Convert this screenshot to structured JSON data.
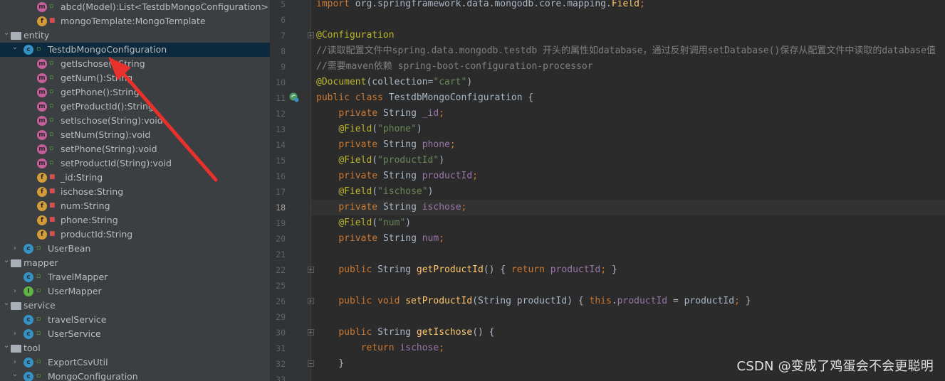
{
  "tree": {
    "rows": [
      {
        "label": "abcd(Model):List<TestdbMongoConfiguration>",
        "icon": "m",
        "vis": "pub",
        "indent": "method"
      },
      {
        "label": "mongoTemplate:MongoTemplate",
        "icon": "f",
        "vis": "priv",
        "indent": "method"
      },
      {
        "label": "entity",
        "icon": "folder",
        "arrow": "down",
        "indent": "pkg"
      },
      {
        "label": "TestdbMongoConfiguration",
        "icon": "c",
        "vis": "pub",
        "arrow": "down",
        "indent": "class",
        "selected": true
      },
      {
        "label": "getIschose():String",
        "icon": "m",
        "vis": "pub",
        "indent": "member"
      },
      {
        "label": "getNum():String",
        "icon": "m",
        "vis": "pub",
        "indent": "member"
      },
      {
        "label": "getPhone():String",
        "icon": "m",
        "vis": "pub",
        "indent": "member"
      },
      {
        "label": "getProductId():String",
        "icon": "m",
        "vis": "pub",
        "indent": "member"
      },
      {
        "label": "setIschose(String):void",
        "icon": "m",
        "vis": "pub",
        "indent": "member"
      },
      {
        "label": "setNum(String):void",
        "icon": "m",
        "vis": "pub",
        "indent": "member"
      },
      {
        "label": "setPhone(String):void",
        "icon": "m",
        "vis": "pub",
        "indent": "member"
      },
      {
        "label": "setProductId(String):void",
        "icon": "m",
        "vis": "pub",
        "indent": "member"
      },
      {
        "label": "_id:String",
        "icon": "f",
        "vis": "priv",
        "indent": "member"
      },
      {
        "label": "ischose:String",
        "icon": "f",
        "vis": "priv",
        "indent": "member"
      },
      {
        "label": "num:String",
        "icon": "f",
        "vis": "priv",
        "indent": "member"
      },
      {
        "label": "phone:String",
        "icon": "f",
        "vis": "priv",
        "indent": "member"
      },
      {
        "label": "productId:String",
        "icon": "f",
        "vis": "priv",
        "indent": "member"
      },
      {
        "label": "UserBean",
        "icon": "c",
        "vis": "pub",
        "arrow": "right",
        "indent": "class"
      },
      {
        "label": "mapper",
        "icon": "folder",
        "arrow": "down",
        "indent": "pkg"
      },
      {
        "label": "TravelMapper",
        "icon": "c",
        "vis": "pub",
        "indent": "class"
      },
      {
        "label": "UserMapper",
        "icon": "i",
        "vis": "pub",
        "arrow": "right",
        "indent": "class"
      },
      {
        "label": "service",
        "icon": "folder",
        "arrow": "down",
        "indent": "pkg"
      },
      {
        "label": "travelService",
        "icon": "c",
        "vis": "pub",
        "indent": "class"
      },
      {
        "label": "UserService",
        "icon": "c",
        "vis": "pub",
        "arrow": "right",
        "indent": "class"
      },
      {
        "label": "tool",
        "icon": "folder",
        "arrow": "down",
        "indent": "pkg"
      },
      {
        "label": "ExportCsvUtil",
        "icon": "c",
        "vis": "pub",
        "arrow": "right",
        "indent": "class"
      },
      {
        "label": "MongoConfiguration",
        "icon": "c",
        "vis": "pub",
        "arrow": "down",
        "indent": "class"
      }
    ]
  },
  "editor": {
    "current_line": "18",
    "lines": [
      {
        "n": "5",
        "html": [
          [
            "kw",
            "import "
          ],
          [
            "",
            "org.springframework.data.mongodb.core.mapping."
          ],
          [
            "fn",
            "Field"
          ],
          [
            "kw",
            ";"
          ]
        ]
      },
      {
        "n": "6",
        "html": []
      },
      {
        "n": "7",
        "html": [
          [
            "an",
            "@Configuration"
          ]
        ]
      },
      {
        "n": "8",
        "html": [
          [
            "cm",
            "//读取配置文件中spring.data.mongodb.testdb 开头的属性如database，通过反射调用setDatabase()保存从配置文件中读取的database值"
          ]
        ]
      },
      {
        "n": "9",
        "html": [
          [
            "cm",
            "//需要maven依赖 spring-boot-configuration-processor"
          ]
        ]
      },
      {
        "n": "10",
        "html": [
          [
            "an",
            "@Document"
          ],
          [
            "",
            "(collection="
          ],
          [
            "st",
            "\"cart\""
          ],
          [
            "",
            ")"
          ]
        ]
      },
      {
        "n": "11",
        "html": [
          [
            "kw",
            "public class "
          ],
          [
            "",
            "TestdbMongoConfiguration {"
          ]
        ]
      },
      {
        "n": "12",
        "html": [
          [
            "",
            "    "
          ],
          [
            "kw",
            "private "
          ],
          [
            "",
            "String "
          ],
          [
            "fd",
            "_id"
          ],
          [
            "kw",
            ";"
          ]
        ]
      },
      {
        "n": "13",
        "html": [
          [
            "",
            "    "
          ],
          [
            "an",
            "@Field"
          ],
          [
            "",
            "("
          ],
          [
            "st",
            "\"phone\""
          ],
          [
            "",
            ")"
          ]
        ]
      },
      {
        "n": "14",
        "html": [
          [
            "",
            "    "
          ],
          [
            "kw",
            "private "
          ],
          [
            "",
            "String "
          ],
          [
            "fd",
            "phone"
          ],
          [
            "kw",
            ";"
          ]
        ]
      },
      {
        "n": "15",
        "html": [
          [
            "",
            "    "
          ],
          [
            "an",
            "@Field"
          ],
          [
            "",
            "("
          ],
          [
            "st",
            "\"productId\""
          ],
          [
            "",
            ")"
          ]
        ]
      },
      {
        "n": "16",
        "html": [
          [
            "",
            "    "
          ],
          [
            "kw",
            "private "
          ],
          [
            "",
            "String "
          ],
          [
            "fd",
            "productId"
          ],
          [
            "kw",
            ";"
          ]
        ]
      },
      {
        "n": "17",
        "html": [
          [
            "",
            "    "
          ],
          [
            "an",
            "@Field"
          ],
          [
            "",
            "("
          ],
          [
            "st",
            "\"ischose\""
          ],
          [
            "",
            ")"
          ]
        ]
      },
      {
        "n": "18",
        "html": [
          [
            "",
            "    "
          ],
          [
            "kw",
            "private "
          ],
          [
            "",
            "String "
          ],
          [
            "fd",
            "ischose"
          ],
          [
            "kw",
            ";"
          ]
        ]
      },
      {
        "n": "19",
        "html": [
          [
            "",
            "    "
          ],
          [
            "an",
            "@Field"
          ],
          [
            "",
            "("
          ],
          [
            "st",
            "\"num\""
          ],
          [
            "",
            ")"
          ]
        ]
      },
      {
        "n": "20",
        "html": [
          [
            "",
            "    "
          ],
          [
            "kw",
            "private "
          ],
          [
            "",
            "String "
          ],
          [
            "fd",
            "num"
          ],
          [
            "kw",
            ";"
          ]
        ]
      },
      {
        "n": "21",
        "html": []
      },
      {
        "n": "22",
        "html": [
          [
            "",
            "    "
          ],
          [
            "kw",
            "public "
          ],
          [
            "",
            "String "
          ],
          [
            "fn",
            "getProductId"
          ],
          [
            "",
            "() { "
          ],
          [
            "kw",
            "return "
          ],
          [
            "fd",
            "productId"
          ],
          [
            "kw",
            ";"
          ],
          [
            "",
            " }"
          ]
        ]
      },
      {
        "n": "25",
        "html": []
      },
      {
        "n": "26",
        "html": [
          [
            "",
            "    "
          ],
          [
            "kw",
            "public void "
          ],
          [
            "fn",
            "setProductId"
          ],
          [
            "",
            "(String productId) { "
          ],
          [
            "kw",
            "this"
          ],
          [
            "",
            "."
          ],
          [
            "fd",
            "productId"
          ],
          [
            "",
            " = productId"
          ],
          [
            "kw",
            ";"
          ],
          [
            "",
            " }"
          ]
        ]
      },
      {
        "n": "29",
        "html": []
      },
      {
        "n": "30",
        "html": [
          [
            "",
            "    "
          ],
          [
            "kw",
            "public "
          ],
          [
            "",
            "String "
          ],
          [
            "fn",
            "getIschose"
          ],
          [
            "",
            "() {"
          ]
        ]
      },
      {
        "n": "31",
        "html": [
          [
            "",
            "        "
          ],
          [
            "kw",
            "return "
          ],
          [
            "fd",
            "ischose"
          ],
          [
            "kw",
            ";"
          ]
        ]
      },
      {
        "n": "32",
        "html": [
          [
            "",
            "    }"
          ]
        ]
      },
      {
        "n": "33",
        "html": []
      }
    ]
  },
  "watermark": "CSDN @变成了鸡蛋会不会更聪明",
  "colors": {
    "selection": "#0d293e",
    "arrow": "#e8312d"
  }
}
